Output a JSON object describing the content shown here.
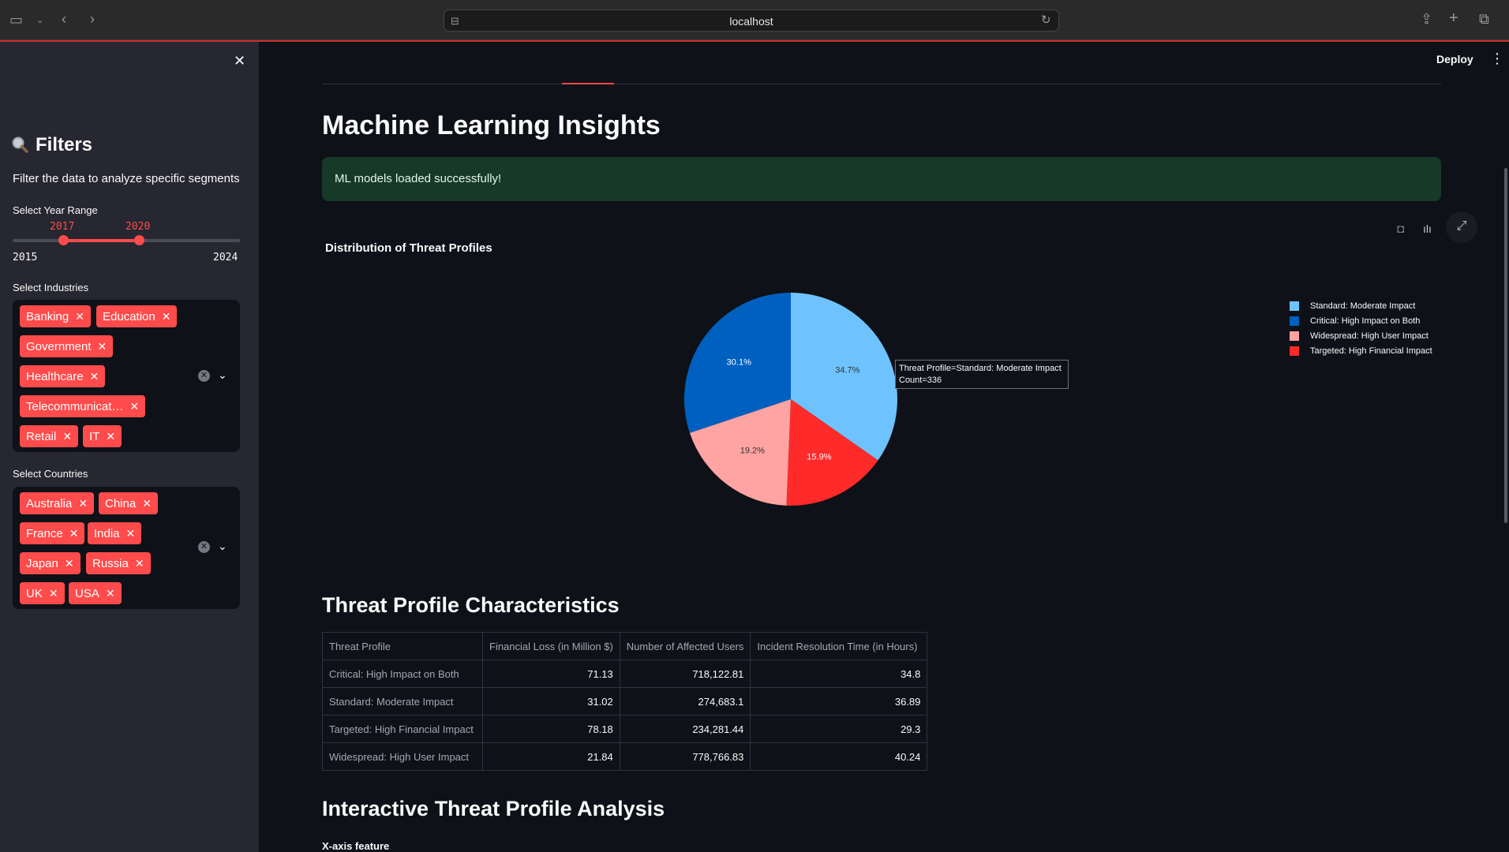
{
  "browser": {
    "url": "localhost"
  },
  "header": {
    "deploy_label": "Deploy"
  },
  "sidebar": {
    "title": "Filters",
    "subtitle": "Filter the data to analyze specific segments",
    "year_range": {
      "label": "Select Year Range",
      "min": "2015",
      "max": "2024",
      "low": "2017",
      "high": "2020"
    },
    "industries": {
      "label": "Select Industries",
      "selected": [
        "Banking",
        "Education",
        "Government",
        "Healthcare",
        "Telecommunicat…",
        "Retail",
        "IT"
      ]
    },
    "countries": {
      "label": "Select Countries",
      "selected": [
        "Australia",
        "China",
        "France",
        "India",
        "Japan",
        "Russia",
        "UK",
        "USA"
      ]
    }
  },
  "main": {
    "title": "Machine Learning Insights",
    "success_message": "ML models loaded successfully!",
    "characteristics_title": "Threat Profile Characteristics",
    "interactive_title": "Interactive Threat Profile Analysis",
    "x_axis_label": "X-axis feature"
  },
  "chart_data": {
    "type": "pie",
    "title": "Distribution of Threat Profiles",
    "slices": [
      {
        "label": "Standard: Moderate Impact",
        "value": 34.7,
        "color": "#6ec3ff",
        "text_color": "#333333"
      },
      {
        "label": "Targeted: High Financial Impact",
        "value": 15.9,
        "color": "#ff2b2b",
        "text_color": "#ffffff"
      },
      {
        "label": "Widespread: High User Impact",
        "value": 19.2,
        "color": "#ffa3a3",
        "text_color": "#333333"
      },
      {
        "label": "Critical: High Impact on Both",
        "value": 30.1,
        "color": "#0060bf",
        "text_color": "#ffffff"
      }
    ],
    "legend": [
      "Standard: Moderate Impact",
      "Critical: High Impact on Both",
      "Widespread: High User Impact",
      "Targeted: High Financial Impact"
    ],
    "legend_colors": [
      "#6ec3ff",
      "#0060bf",
      "#ffa3a3",
      "#ff2b2b"
    ],
    "legend_position": "top-right",
    "tooltip": {
      "line1": "Threat Profile=Standard: Moderate Impact",
      "line2": "Count=336"
    }
  },
  "table": {
    "headers": [
      "Threat Profile",
      "Financial Loss (in Million $)",
      "Number of Affected Users",
      "Incident Resolution Time (in Hours)"
    ],
    "rows": [
      [
        "Critical: High Impact on Both",
        "71.13",
        "718,122.81",
        "34.8"
      ],
      [
        "Standard: Moderate Impact",
        "31.02",
        "274,683.1",
        "36.89"
      ],
      [
        "Targeted: High Financial Impact",
        "78.18",
        "234,281.44",
        "29.3"
      ],
      [
        "Widespread: High User Impact",
        "21.84",
        "778,766.83",
        "40.24"
      ]
    ]
  }
}
